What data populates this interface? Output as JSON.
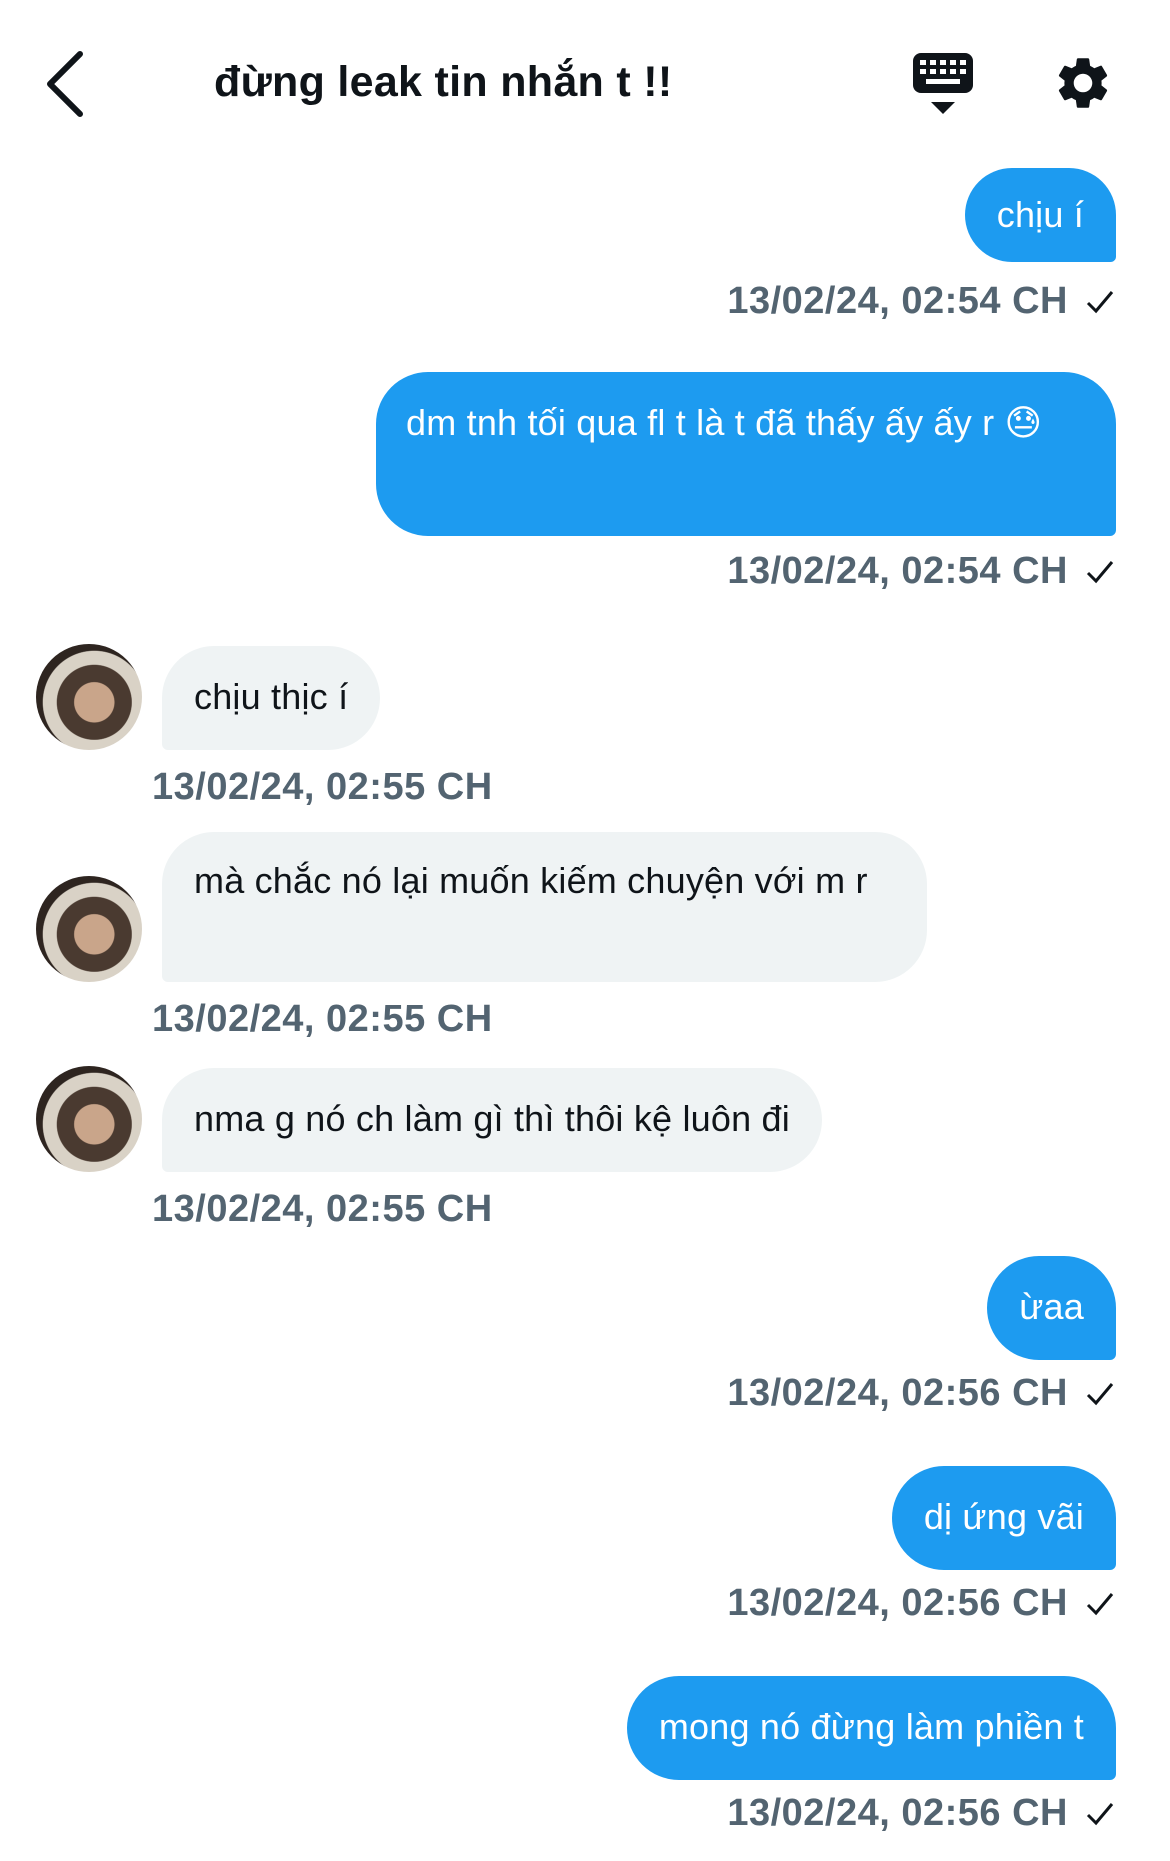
{
  "header": {
    "title": "đừng leak tin nhắn t !!",
    "back_icon": "chevron-left-icon",
    "keyboard_icon": "keyboard-icon",
    "settings_icon": "gear-icon"
  },
  "colors": {
    "sent": "#1d9bf0",
    "received": "#eff3f4",
    "timestamp": "#536471"
  },
  "messages": [
    {
      "dir": "sent",
      "text": "chịu í",
      "time": "13/02/24, 02:54 CH"
    },
    {
      "dir": "sent",
      "text": "dm tnh tối qua fl t là t đã thấy ấy ấy r 😓",
      "time": "13/02/24, 02:54 CH"
    },
    {
      "dir": "received",
      "text": "chịu thịc í",
      "time": "13/02/24, 02:55 CH"
    },
    {
      "dir": "received",
      "text": "mà chắc nó lại muốn kiếm chuyện với m r",
      "time": "13/02/24, 02:55 CH"
    },
    {
      "dir": "received",
      "text": "nma g nó ch làm gì thì thôi kệ luôn đi",
      "time": "13/02/24, 02:55 CH"
    },
    {
      "dir": "sent",
      "text": "ừaa",
      "time": "13/02/24, 02:56 CH"
    },
    {
      "dir": "sent",
      "text": "dị ứng vãi",
      "time": "13/02/24, 02:56 CH"
    },
    {
      "dir": "sent",
      "text": "mong nó đừng làm phiền t",
      "time": "13/02/24, 02:56 CH"
    }
  ]
}
